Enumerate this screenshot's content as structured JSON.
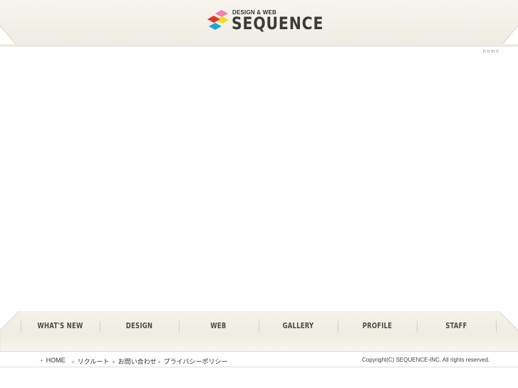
{
  "header": {
    "logo_small": "DESIGN & WEB",
    "logo_big": "SEQUENCE",
    "breadcrumb": "home"
  },
  "colors": {
    "diamond_pink": "#f27fb5",
    "diamond_yellow": "#f5d91a",
    "diamond_red": "#e8332a",
    "diamond_blue": "#1fa5dc",
    "band": "#f2efe5"
  },
  "nav": {
    "items": [
      "WHAT'S NEW",
      "DESIGN",
      "WEB",
      "GALLERY",
      "PROFILE",
      "STAFF"
    ]
  },
  "footer": {
    "links": [
      "HOME",
      "リクルート",
      "お問い合わせ",
      "プライバシーポリシー"
    ],
    "copyright": "Copyright(C) SEQUENCE-INC. All rights reserved."
  }
}
